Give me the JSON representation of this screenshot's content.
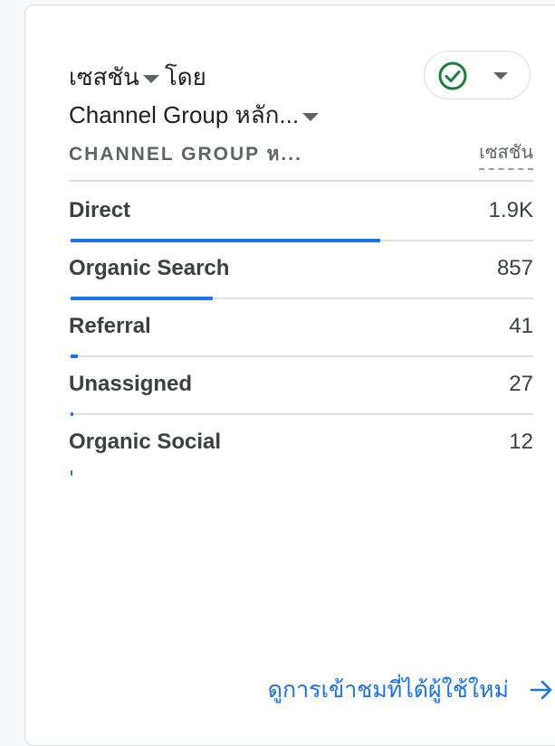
{
  "card": {
    "title_line1": "เซสชัน",
    "title_line1_suffix": "โดย",
    "title_line2": "Channel Group หลัก...",
    "status_icon": "check-circle-icon",
    "status_color": "#188038"
  },
  "table": {
    "dimension_header": "CHANNEL GROUP ห...",
    "metric_header": "เซสชัน",
    "rows": [
      {
        "label": "Direct",
        "value": "1.9K",
        "share": 0.667
      },
      {
        "label": "Organic Search",
        "value": "857",
        "share": 0.307
      },
      {
        "label": "Referral",
        "value": "41",
        "share": 0.015
      },
      {
        "label": "Unassigned",
        "value": "27",
        "share": 0.006
      },
      {
        "label": "Organic Social",
        "value": "12",
        "share": 0.002
      }
    ],
    "bar_color": "#1a73e8"
  },
  "footer": {
    "link_label": "ดูการเข้าชมที่ได้ผู้ใช้ใหม่",
    "link_icon": "arrow-right-icon"
  }
}
